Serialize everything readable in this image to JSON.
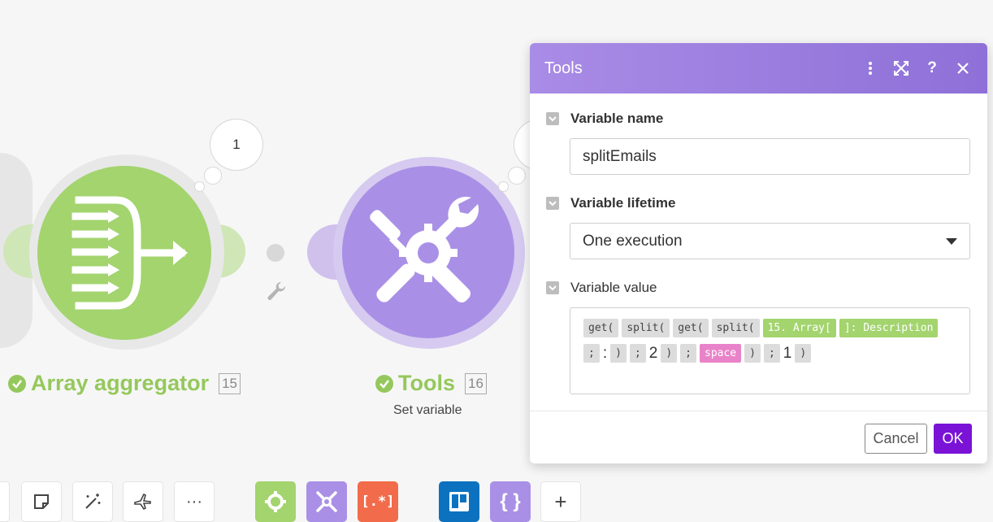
{
  "canvas": {
    "aggregator": {
      "label": "Array aggregator",
      "number": "15",
      "bubble_count": "1"
    },
    "tools": {
      "label": "Tools",
      "number": "16",
      "subtitle": "Set variable"
    }
  },
  "toolbar": {
    "icons": [
      "note-icon",
      "magic-wand-icon",
      "airplane-icon",
      "more-icon",
      "flow-control-gear-icon",
      "tools-icon",
      "array-bracket-icon",
      "trello-icon",
      "json-braces-icon",
      "add-icon"
    ],
    "more_label": "···",
    "add_label": "+"
  },
  "dialog": {
    "title": "Tools",
    "header_icons": [
      "more-vertical-icon",
      "expand-icon",
      "help-icon",
      "close-icon"
    ],
    "fields": {
      "variable_name": {
        "label": "Variable name",
        "value": "splitEmails"
      },
      "variable_lifetime": {
        "label": "Variable lifetime",
        "value": "One execution"
      },
      "variable_value": {
        "label": "Variable value",
        "tokens": [
          {
            "text": "get(",
            "kind": "func"
          },
          {
            "text": "split(",
            "kind": "func"
          },
          {
            "text": "get(",
            "kind": "func"
          },
          {
            "text": "split(",
            "kind": "func"
          },
          {
            "text": "15. Array[",
            "kind": "var"
          },
          {
            "text": "]: Description",
            "kind": "var"
          },
          {
            "text": ";",
            "kind": "func"
          },
          {
            "text": ":",
            "kind": "literal"
          },
          {
            "text": ")",
            "kind": "func"
          },
          {
            "text": ";",
            "kind": "func"
          },
          {
            "text": "2",
            "kind": "literal"
          },
          {
            "text": ")",
            "kind": "func"
          },
          {
            "text": ";",
            "kind": "func"
          },
          {
            "text": "space",
            "kind": "keyword"
          },
          {
            "text": ")",
            "kind": "func"
          },
          {
            "text": ";",
            "kind": "func"
          },
          {
            "text": "1",
            "kind": "literal"
          },
          {
            "text": ")",
            "kind": "func"
          }
        ]
      }
    },
    "buttons": {
      "cancel": "Cancel",
      "ok": "OK"
    }
  },
  "colors": {
    "aggregator_green": "#a3d46e",
    "tools_purple": "#a990e6",
    "ok_purple": "#7a13d6",
    "header_gradient": [
      "#a98ce6",
      "#8e70d8"
    ]
  }
}
